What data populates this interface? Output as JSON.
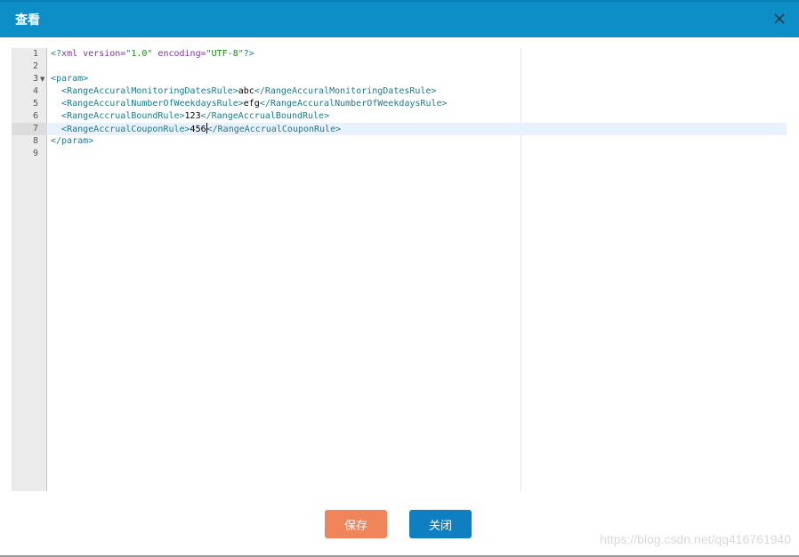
{
  "dialog": {
    "title": "查看"
  },
  "editor": {
    "lines": [
      {
        "num": "1"
      },
      {
        "num": "2"
      },
      {
        "num": "3"
      },
      {
        "num": "4"
      },
      {
        "num": "5"
      },
      {
        "num": "6"
      },
      {
        "num": "7"
      },
      {
        "num": "8"
      },
      {
        "num": "9"
      }
    ],
    "code": {
      "l1_open": "<?",
      "l1_xml": "xml",
      "l1_version_attr": " version=",
      "l1_version_val": "\"1.0\"",
      "l1_encoding_attr": " encoding=",
      "l1_encoding_val": "\"UTF-8\"",
      "l1_close": "?>",
      "l3_tag": "<param>",
      "l4_indent": "  ",
      "l4_open": "<RangeAccuralMonitoringDatesRule>",
      "l4_text": "abc",
      "l4_close": "</RangeAccuralMonitoringDatesRule>",
      "l5_indent": "  ",
      "l5_open": "<RangeAccuralNumberOfWeekdaysRule>",
      "l5_text": "efg",
      "l5_close": "</RangeAccuralNumberOfWeekdaysRule>",
      "l6_indent": "  ",
      "l6_open": "<RangeAccrualBoundRule>",
      "l6_text": "123",
      "l6_close": "</RangeAccrualBoundRule>",
      "l7_indent": "  ",
      "l7_open": "<RangeAccrualCouponRule>",
      "l7_text": "456",
      "l7_close": "</RangeAccrualCouponRule>",
      "l8_tag": "</param>"
    }
  },
  "buttons": {
    "save_label": "保存",
    "close_label": "关闭"
  },
  "watermark": "https://blog.csdn.net/qq416761940",
  "colors": {
    "titlebar": "#0e8ec7",
    "save_button": "#f0845a",
    "close_button": "#0e7fc1",
    "active_line": "#e8f2fe"
  }
}
